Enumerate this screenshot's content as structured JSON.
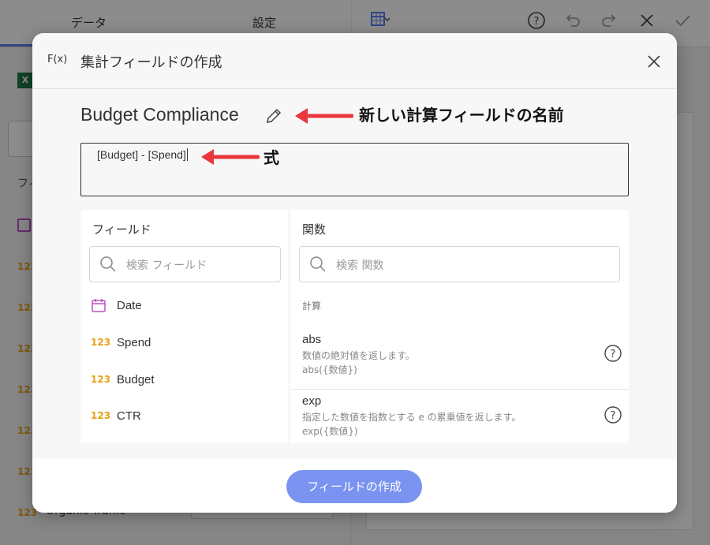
{
  "background": {
    "tabs": [
      "データ",
      "設定"
    ],
    "left_items": [
      "フィ",
      "Organic Traffic"
    ],
    "number_badge": "123",
    "excel_badge": "X"
  },
  "dialog": {
    "icon": "F(x)",
    "title": "集計フィールドの作成",
    "field_name": "Budget Compliance",
    "formula": "[Budget] - [Spend]",
    "fields_panel": {
      "header": "フィールド",
      "search_placeholder": "検索 フィールド",
      "items": [
        {
          "icon": "calendar-icon",
          "label": "Date"
        },
        {
          "icon": "123",
          "label": "Spend"
        },
        {
          "icon": "123",
          "label": "Budget"
        },
        {
          "icon": "123",
          "label": "CTR"
        }
      ]
    },
    "functions_panel": {
      "header": "関数",
      "search_placeholder": "検索 関数",
      "section": "計算",
      "items": [
        {
          "name": "abs",
          "description": "数値の絶対値を返します。",
          "signature": "abs({数値})"
        },
        {
          "name": "exp",
          "description": "指定した数値を指数とする e の累乗値を返します。",
          "signature": "exp({数値})"
        }
      ]
    },
    "create_button": "フィールドの作成"
  },
  "annotations": {
    "name_note": "新しい計算フィールドの名前",
    "formula_note": "式"
  },
  "colors": {
    "accent": "#7b93f0",
    "number_icon": "#e8a013",
    "calendar_icon": "#c24dc6",
    "arrow": "#e8383d"
  }
}
